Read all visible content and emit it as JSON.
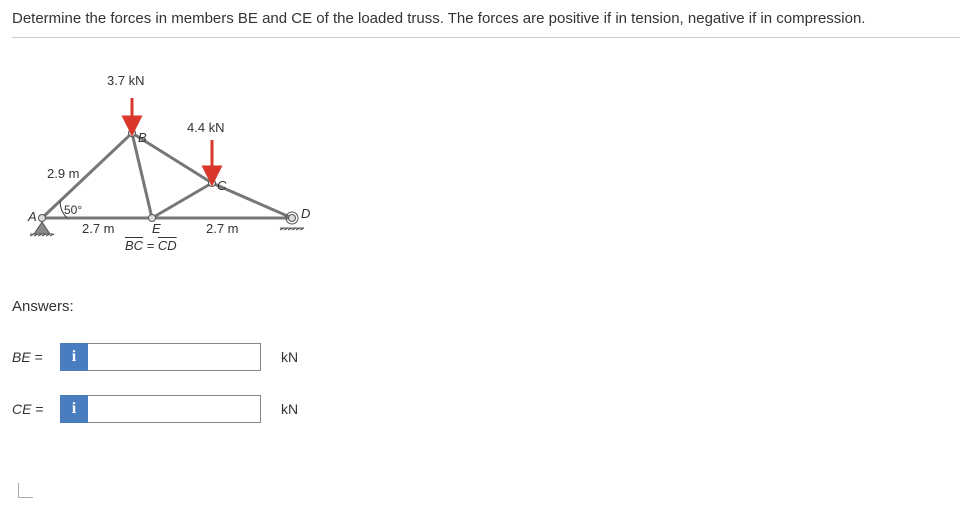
{
  "question": "Determine the forces in members BE and CE of the loaded truss. The forces are positive if in tension, negative if in compression.",
  "diagram": {
    "load_top": "3.7 kN",
    "load_right": "4.4 kN",
    "len_AB": "2.9 m",
    "angle_A": "50°",
    "len_AE": "2.7 m",
    "len_ED": "2.7 m",
    "node_A": "A",
    "node_B": "B",
    "node_C": "C",
    "node_D": "D",
    "node_E": "E",
    "eq_line": "BC = CD",
    "eq_over1": "BC",
    "eq_over2": "CD"
  },
  "answers": {
    "title": "Answers:",
    "rows": [
      {
        "label": "BE",
        "eq": "=",
        "unit": "kN",
        "value": ""
      },
      {
        "label": "CE",
        "eq": "=",
        "unit": "kN",
        "value": ""
      }
    ],
    "info_icon": "i"
  }
}
